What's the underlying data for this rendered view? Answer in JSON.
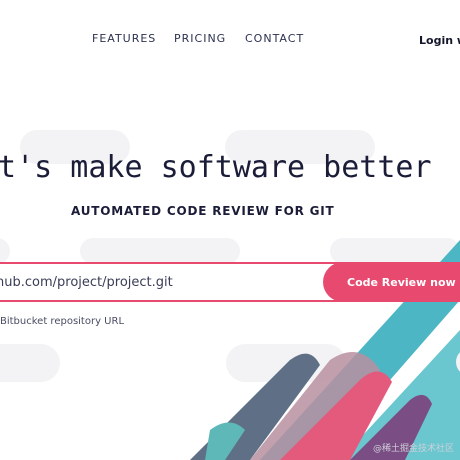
{
  "nav": {
    "items": [
      {
        "label": "FEATURES"
      },
      {
        "label": "PRICING"
      },
      {
        "label": "CONTACT"
      }
    ],
    "login_label": "Login wit"
  },
  "hero": {
    "title": "et's make software better",
    "subtitle": "AUTOMATED CODE REVIEW FOR GIT"
  },
  "repo_form": {
    "input_value": "hub.com/project/project.git",
    "submit_label": "Code Review now",
    "hint": "Bitbucket repository URL"
  },
  "watermark": "@稀土掘金技术社区",
  "colors": {
    "accent": "#e7496f",
    "text_dark": "#1b1d38",
    "stripe_teal": "#4cb6c4",
    "stripe_pink": "#e35a7c",
    "stripe_slate": "#5f6f86"
  }
}
